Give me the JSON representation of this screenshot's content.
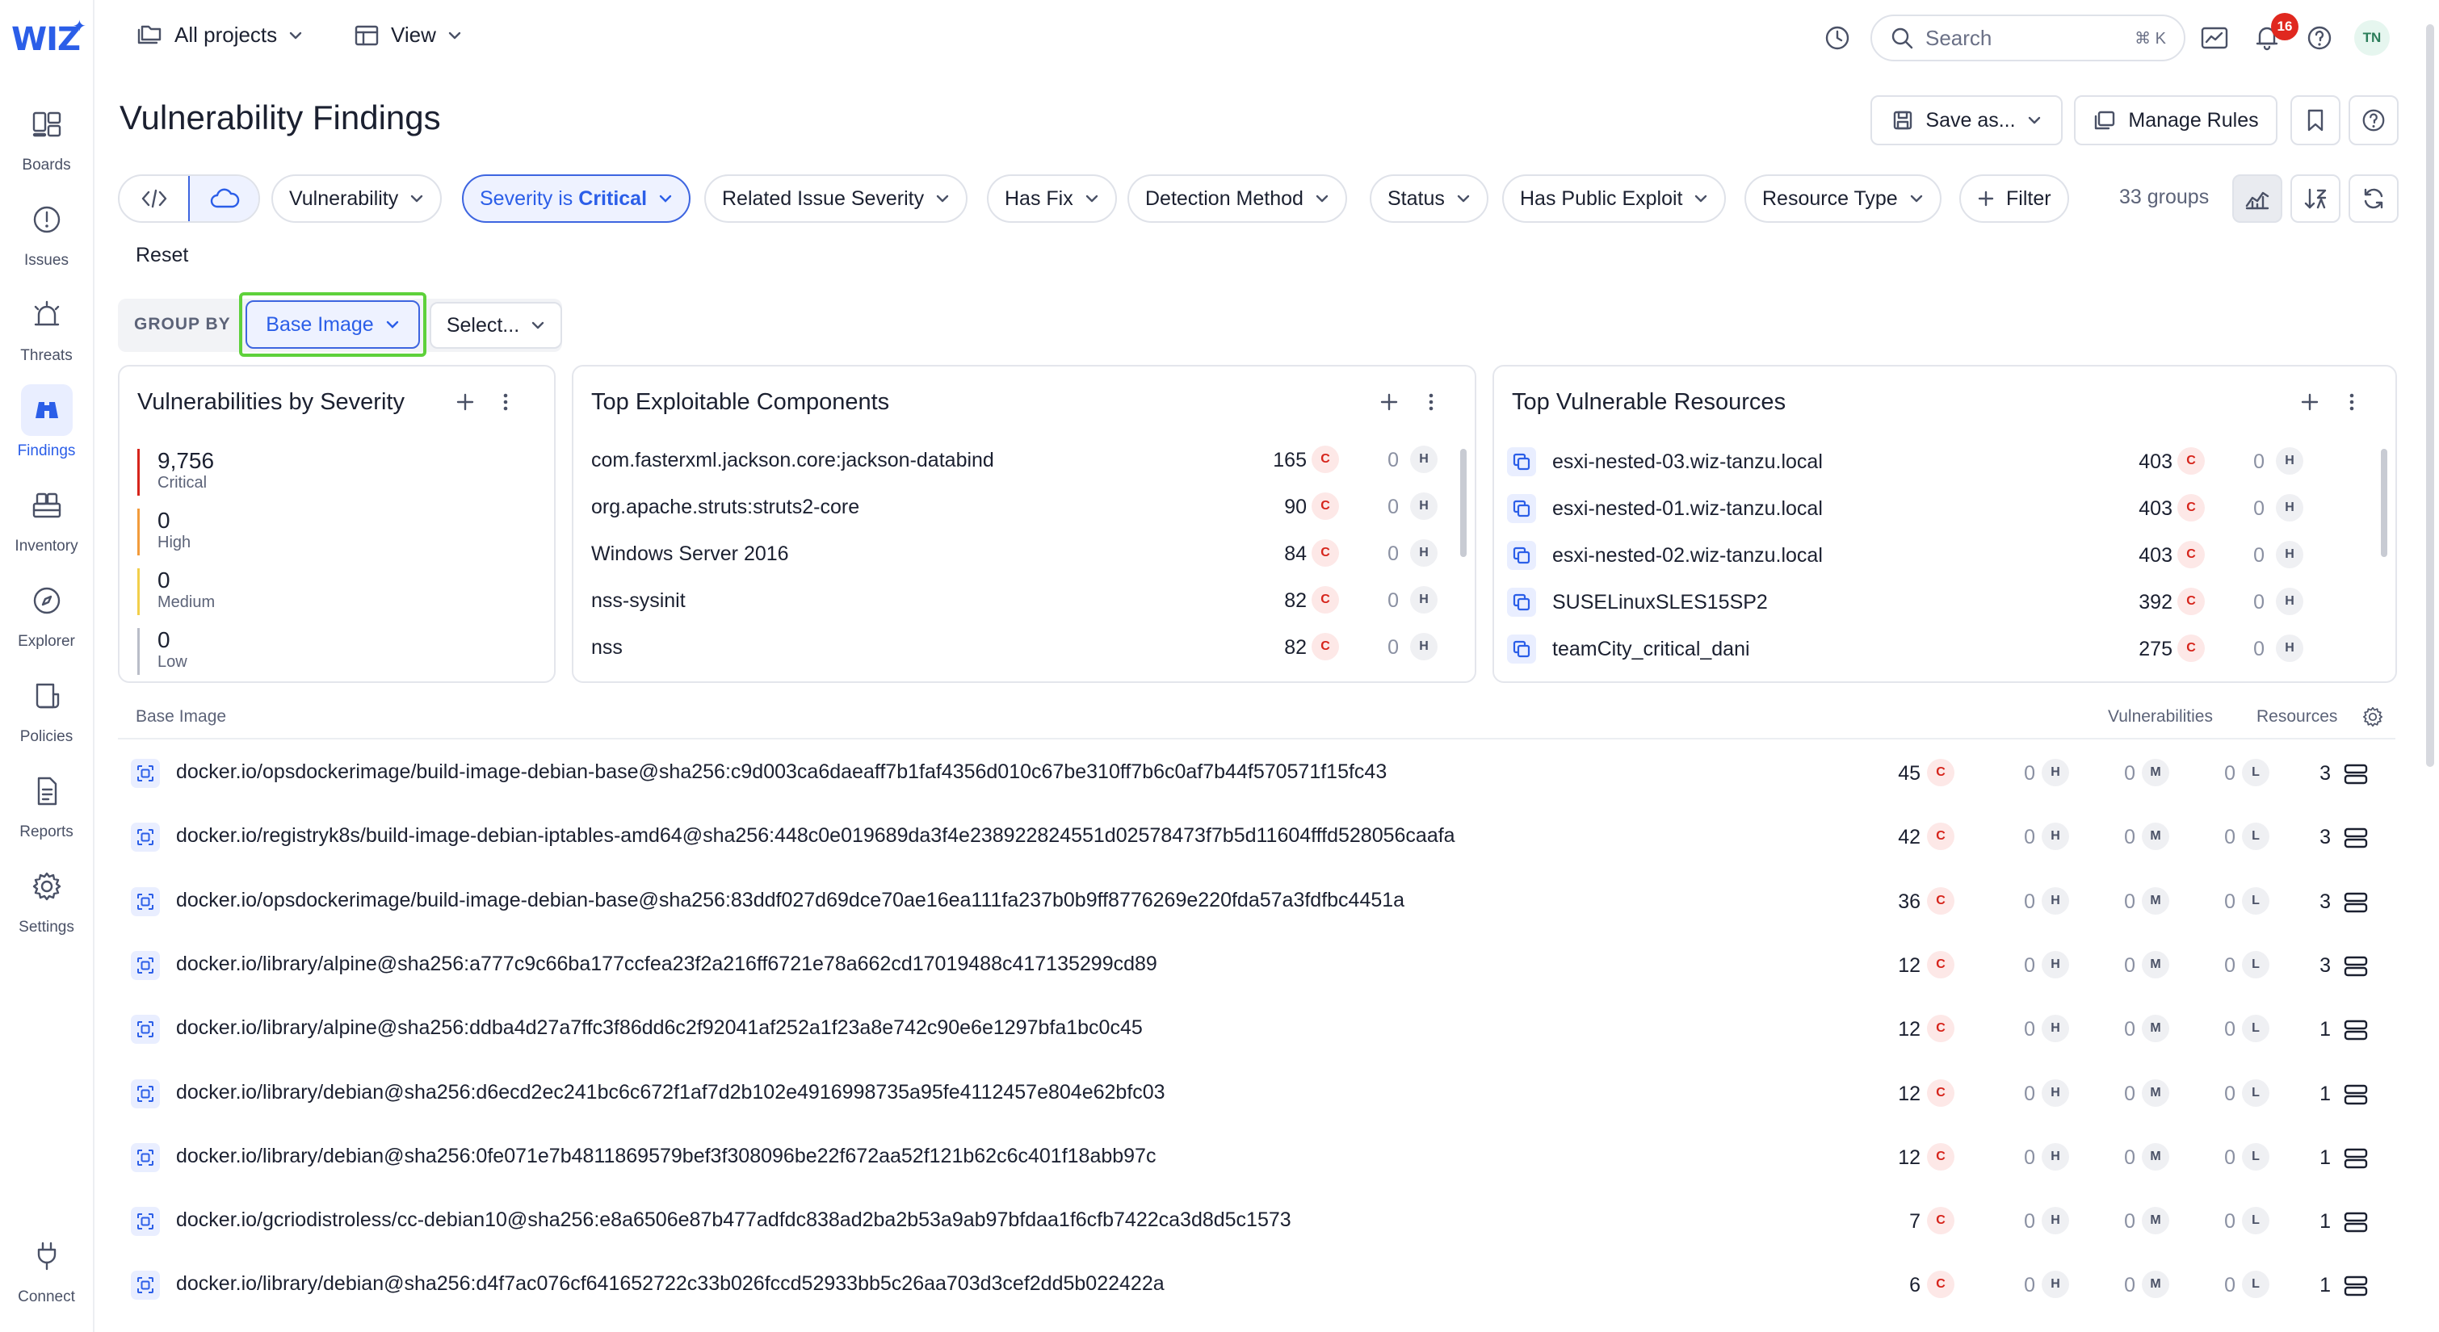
{
  "sidebar": {
    "logo": "WIZ",
    "items": [
      {
        "label": "Boards",
        "icon": "boards-icon"
      },
      {
        "label": "Issues",
        "icon": "issues-icon"
      },
      {
        "label": "Threats",
        "icon": "threats-icon"
      },
      {
        "label": "Findings",
        "icon": "findings-icon",
        "active": true
      },
      {
        "label": "Inventory",
        "icon": "inventory-icon"
      },
      {
        "label": "Explorer",
        "icon": "explorer-icon"
      },
      {
        "label": "Policies",
        "icon": "policies-icon"
      },
      {
        "label": "Reports",
        "icon": "reports-icon"
      },
      {
        "label": "Settings",
        "icon": "settings-icon"
      }
    ],
    "connect_label": "Connect"
  },
  "topbar": {
    "projects_label": "All projects",
    "view_label": "View",
    "search_placeholder": "Search",
    "search_shortcut": "⌘ K",
    "notifications_count": "16",
    "avatar_initials": "TN"
  },
  "header": {
    "title": "Vulnerability Findings",
    "save_as_label": "Save as...",
    "manage_rules_label": "Manage Rules"
  },
  "filters": {
    "chips": [
      {
        "label": "Vulnerability"
      },
      {
        "label_prefix": "Severity is ",
        "label_value": "Critical",
        "selected": true
      },
      {
        "label": "Related Issue Severity"
      },
      {
        "label": "Has Fix"
      },
      {
        "label": "Detection Method"
      },
      {
        "label": "Status"
      },
      {
        "label": "Has Public Exploit"
      },
      {
        "label": "Resource Type"
      }
    ],
    "add_filter_label": "Filter",
    "groups_count": "33 groups",
    "reset_label": "Reset"
  },
  "group_by": {
    "label": "GROUP BY",
    "selected": "Base Image",
    "second_placeholder": "Select..."
  },
  "widgets": {
    "severity": {
      "title": "Vulnerabilities by Severity",
      "entries": [
        {
          "count": "9,756",
          "label": "Critical",
          "color": "#d6241b"
        },
        {
          "count": "0",
          "label": "High",
          "color": "#f29b3b"
        },
        {
          "count": "0",
          "label": "Medium",
          "color": "#f2cf4a"
        },
        {
          "count": "0",
          "label": "Low",
          "color": "#b9bdc8"
        }
      ]
    },
    "components": {
      "title": "Top Exploitable Components",
      "rows": [
        {
          "name": "com.fasterxml.jackson.core:jackson-databind",
          "critical": "165",
          "high": "0"
        },
        {
          "name": "org.apache.struts:struts2-core",
          "critical": "90",
          "high": "0"
        },
        {
          "name": "Windows Server 2016",
          "critical": "84",
          "high": "0"
        },
        {
          "name": "nss-sysinit",
          "critical": "82",
          "high": "0"
        },
        {
          "name": "nss",
          "critical": "82",
          "high": "0"
        }
      ]
    },
    "resources": {
      "title": "Top Vulnerable Resources",
      "rows": [
        {
          "name": "esxi-nested-03.wiz-tanzu.local",
          "critical": "403",
          "high": "0"
        },
        {
          "name": "esxi-nested-01.wiz-tanzu.local",
          "critical": "403",
          "high": "0"
        },
        {
          "name": "esxi-nested-02.wiz-tanzu.local",
          "critical": "403",
          "high": "0"
        },
        {
          "name": "SUSELinuxSLES15SP2",
          "critical": "392",
          "high": "0"
        },
        {
          "name": "teamCity_critical_dani",
          "critical": "275",
          "high": "0"
        }
      ]
    }
  },
  "severity_letters": {
    "critical": "C",
    "high": "H",
    "medium": "M",
    "low": "L"
  },
  "table": {
    "headers": {
      "name": "Base Image",
      "vulns": "Vulnerabilities",
      "resources": "Resources"
    },
    "rows": [
      {
        "name": "docker.io/opsdockerimage/build-image-debian-base@sha256:c9d003ca6daeaff7b1faf4356d010c67be310ff7b6c0af7b44f570571f15fc43",
        "c": "45",
        "h": "0",
        "m": "0",
        "l": "0",
        "res": "3"
      },
      {
        "name": "docker.io/registryk8s/build-image-debian-iptables-amd64@sha256:448c0e019689da3f4e238922824551d02578473f7b5d11604fffd528056caafa",
        "c": "42",
        "h": "0",
        "m": "0",
        "l": "0",
        "res": "3"
      },
      {
        "name": "docker.io/opsdockerimage/build-image-debian-base@sha256:83ddf027d69dce70ae16ea111fa237b0b9ff8776269e220fda57a3fdfbc4451a",
        "c": "36",
        "h": "0",
        "m": "0",
        "l": "0",
        "res": "3"
      },
      {
        "name": "docker.io/library/alpine@sha256:a777c9c66ba177ccfea23f2a216ff6721e78a662cd17019488c417135299cd89",
        "c": "12",
        "h": "0",
        "m": "0",
        "l": "0",
        "res": "3"
      },
      {
        "name": "docker.io/library/alpine@sha256:ddba4d27a7ffc3f86dd6c2f92041af252a1f23a8e742c90e6e1297bfa1bc0c45",
        "c": "12",
        "h": "0",
        "m": "0",
        "l": "0",
        "res": "1"
      },
      {
        "name": "docker.io/library/debian@sha256:d6ecd2ec241bc6c672f1af7d2b102e4916998735a95fe4112457e804e62bfc03",
        "c": "12",
        "h": "0",
        "m": "0",
        "l": "0",
        "res": "1"
      },
      {
        "name": "docker.io/library/debian@sha256:0fe071e7b4811869579bef3f308096be22f672aa52f121b62c6c401f18abb97c",
        "c": "12",
        "h": "0",
        "m": "0",
        "l": "0",
        "res": "1"
      },
      {
        "name": "docker.io/gcriodistroless/cc-debian10@sha256:e8a6506e87b477adfdc838ad2ba2b53a9ab97bfdaa1f6cfb7422ca3d8d5c1573",
        "c": "7",
        "h": "0",
        "m": "0",
        "l": "0",
        "res": "1"
      },
      {
        "name": "docker.io/library/debian@sha256:d4f7ac076cf641652722c33b026fccd52933bb5c26aa703d3cef2dd5b022422a",
        "c": "6",
        "h": "0",
        "m": "0",
        "l": "0",
        "res": "1"
      }
    ]
  }
}
